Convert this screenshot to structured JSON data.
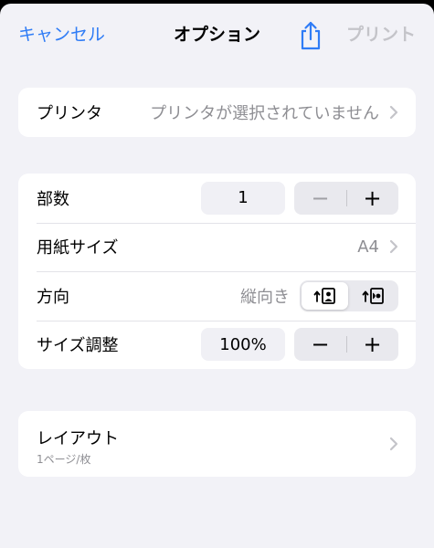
{
  "navbar": {
    "cancel_label": "キャンセル",
    "title": "オプション",
    "share_icon": "share-icon",
    "print_label": "プリント"
  },
  "printer": {
    "label": "プリンタ",
    "value": "プリンタが選択されていません"
  },
  "options": {
    "copies": {
      "label": "部数",
      "value": "1",
      "minus": "−",
      "plus": "+"
    },
    "paper_size": {
      "label": "用紙サイズ",
      "value": "A4"
    },
    "orientation": {
      "label": "方向",
      "value": "縦向き",
      "selected": "portrait"
    },
    "scale": {
      "label": "サイズ調整",
      "value": "100%",
      "minus": "−",
      "plus": "+"
    }
  },
  "layout": {
    "label": "レイアウト",
    "subtitle": "1ページ/枚"
  },
  "colors": {
    "accent": "#2f7cf6",
    "disabled": "#c4c4c9",
    "secondary_text": "#8e8e93",
    "background": "#f2f2f7"
  }
}
